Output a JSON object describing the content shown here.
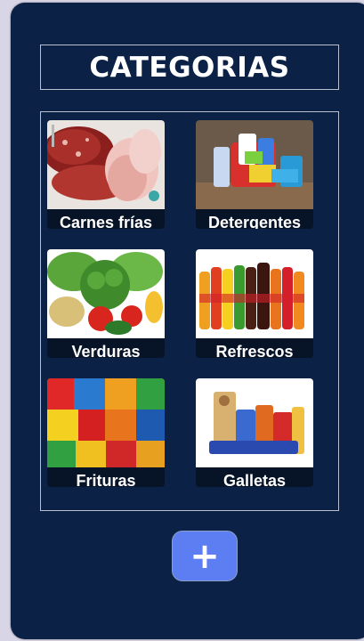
{
  "header": {
    "title": "CATEGORIAS"
  },
  "categories": [
    {
      "label": "Carnes frías",
      "icon": "cold-cuts-photo"
    },
    {
      "label": "Detergentes",
      "icon": "cleaning-products-photo"
    },
    {
      "label": "Verduras",
      "icon": "vegetables-photo"
    },
    {
      "label": "Refrescos",
      "icon": "soda-bottles-photo"
    },
    {
      "label": "Frituras",
      "icon": "chips-bags-photo"
    },
    {
      "label": "Galletas",
      "icon": "cookies-packages-photo"
    }
  ],
  "add_button": {
    "label": "+",
    "icon": "plus-icon"
  },
  "colors": {
    "panel": "#0b2246",
    "accent": "#5d7ef2",
    "border": "#b9c1cf"
  }
}
